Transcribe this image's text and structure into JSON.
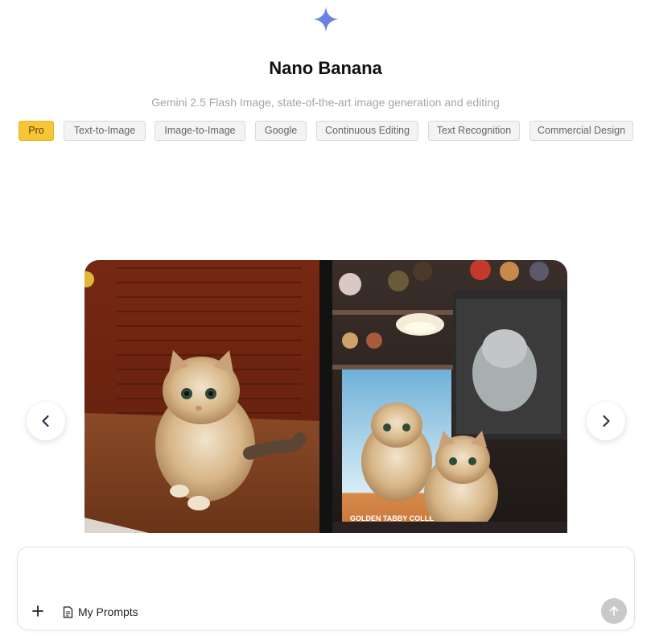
{
  "header": {
    "logo_icon": "sparkle-icon",
    "title": "Nano Banana",
    "subtitle": "Gemini 2.5 Flash Image, state-of-the-art image generation and editing"
  },
  "tags": [
    {
      "label": "Pro",
      "active": true
    },
    {
      "label": "Text-to-Image",
      "active": false
    },
    {
      "label": "Image-to-Image",
      "active": false
    },
    {
      "label": "Google",
      "active": false
    },
    {
      "label": "Continuous Editing",
      "active": false
    },
    {
      "label": "Text Recognition",
      "active": false
    },
    {
      "label": "Commercial Design",
      "active": false
    }
  ],
  "carousel": {
    "prev_icon": "chevron-left-icon",
    "next_icon": "chevron-right-icon",
    "image_text": "GOLDEN TABBY COLLECT"
  },
  "composer": {
    "input_value": "",
    "add_icon": "plus-icon",
    "my_prompts_icon": "document-icon",
    "my_prompts_label": "My Prompts",
    "send_icon": "arrow-up-icon"
  },
  "colors": {
    "accent": "#f8c536",
    "tag_bg": "#f3f3f3",
    "send_disabled": "#c9c9c9"
  }
}
